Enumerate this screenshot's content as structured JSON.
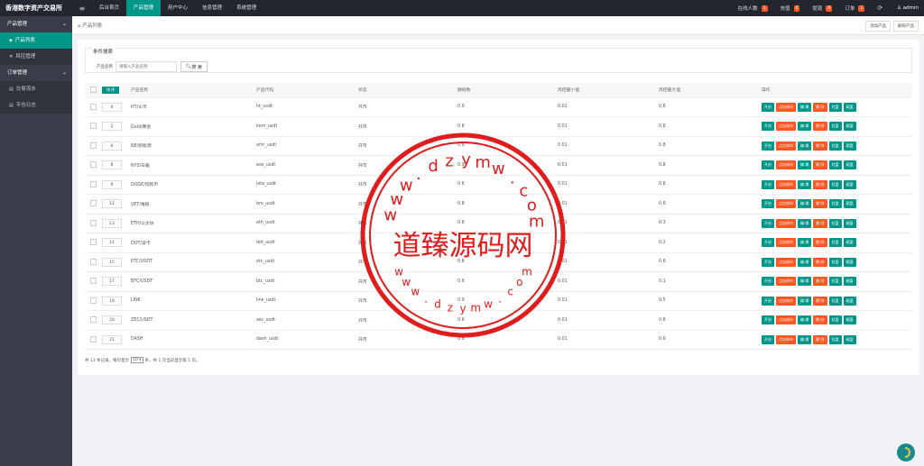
{
  "topbar": {
    "brand": "香港数字资产交易所",
    "nav": [
      "后台首页",
      "产品管理",
      "用户中心",
      "信息管理",
      "系统管理"
    ],
    "active_nav_index": 1,
    "right": [
      {
        "label": "在线人数",
        "badge": "1"
      },
      {
        "label": "充值",
        "badge": "0"
      },
      {
        "label": "提现",
        "badge": "0"
      },
      {
        "label": "订单",
        "badge": "1"
      }
    ],
    "user": "admin"
  },
  "sidebar": {
    "groups": [
      {
        "label": "产品管理",
        "items": [
          "产品列表",
          "风控管理"
        ]
      },
      {
        "label": "订单管理",
        "items": [
          "交易流水",
          "平仓日志"
        ]
      }
    ]
  },
  "breadcrumb": "产品列表",
  "top_buttons": [
    "添加产品",
    "删除产品"
  ],
  "search": {
    "legend": "条件搜索",
    "label": "产品名称",
    "placeholder": "请输入产品名称",
    "button": "搜 索"
  },
  "table": {
    "sort_button": "排 序",
    "headers": [
      "产品名称",
      "产品代码",
      "状态",
      "翻倍数",
      "风控最小值",
      "风控最大值",
      "操作"
    ],
    "op_labels": [
      "开启",
      "点击休市",
      "编 辑",
      "删 除",
      "拉盘",
      "砸盘"
    ],
    "rows": [
      [
        "0",
        "HT/火币",
        "ht_usdt",
        "开市",
        "0.9",
        "0.01",
        "0.6"
      ],
      [
        "2",
        "Gold/黄金",
        "korn_usdt",
        "开市",
        "0.8",
        "0.01",
        "0.6"
      ],
      [
        "6",
        "NE/新能源",
        "xmr_usdt",
        "开市",
        "0.6",
        "0.01",
        "0.8"
      ],
      [
        "8",
        "NYS/日籍",
        "eos_usdt",
        "开市",
        "0.9",
        "0.01",
        "0.8"
      ],
      [
        "9",
        "DOGE/狗狗币",
        "iota_usdt",
        "开市",
        "0.6",
        "0.01",
        "0.6"
      ],
      [
        "12",
        "VET/唯链",
        "bro_usdt",
        "开市",
        "0.8",
        "0.01",
        "0.6"
      ],
      [
        "13",
        "ETH/以太坊",
        "eth_usdt",
        "开市",
        "0.8",
        "0.01",
        "0.3"
      ],
      [
        "14",
        "DOT/波卡",
        "dot_usdt",
        "开市",
        "0.6",
        "0.01",
        "0.2"
      ],
      [
        "15",
        "ETC/USDT",
        "etc_usdt",
        "开市",
        "0.8",
        "0.01",
        "0.6"
      ],
      [
        "17",
        "BTC/USDT",
        "btc_usdt",
        "开市",
        "0.6",
        "0.01",
        "0.1"
      ],
      [
        "19",
        "LINK",
        "link_usdt",
        "开市",
        "0.9",
        "0.01",
        "0.5"
      ],
      [
        "20",
        "ZEC/USDT",
        "zec_usdt",
        "开市",
        "0.6",
        "0.01",
        "0.6"
      ],
      [
        "21",
        "DASH",
        "dash_usdt",
        "开市",
        "0.9",
        "0.01",
        "0.6"
      ]
    ]
  },
  "footer": {
    "pre": "共 13 条记录，每页显示",
    "per_page": "10",
    "post": "条，共 1 页当前显示第 1 页。"
  },
  "watermark": {
    "center": "道臻源码网",
    "ring": "www.dzymw.com"
  },
  "colors": {
    "accent": "#009688",
    "danger": "#ff5722",
    "topbar": "#23262e",
    "sidebar": "#393d49"
  }
}
